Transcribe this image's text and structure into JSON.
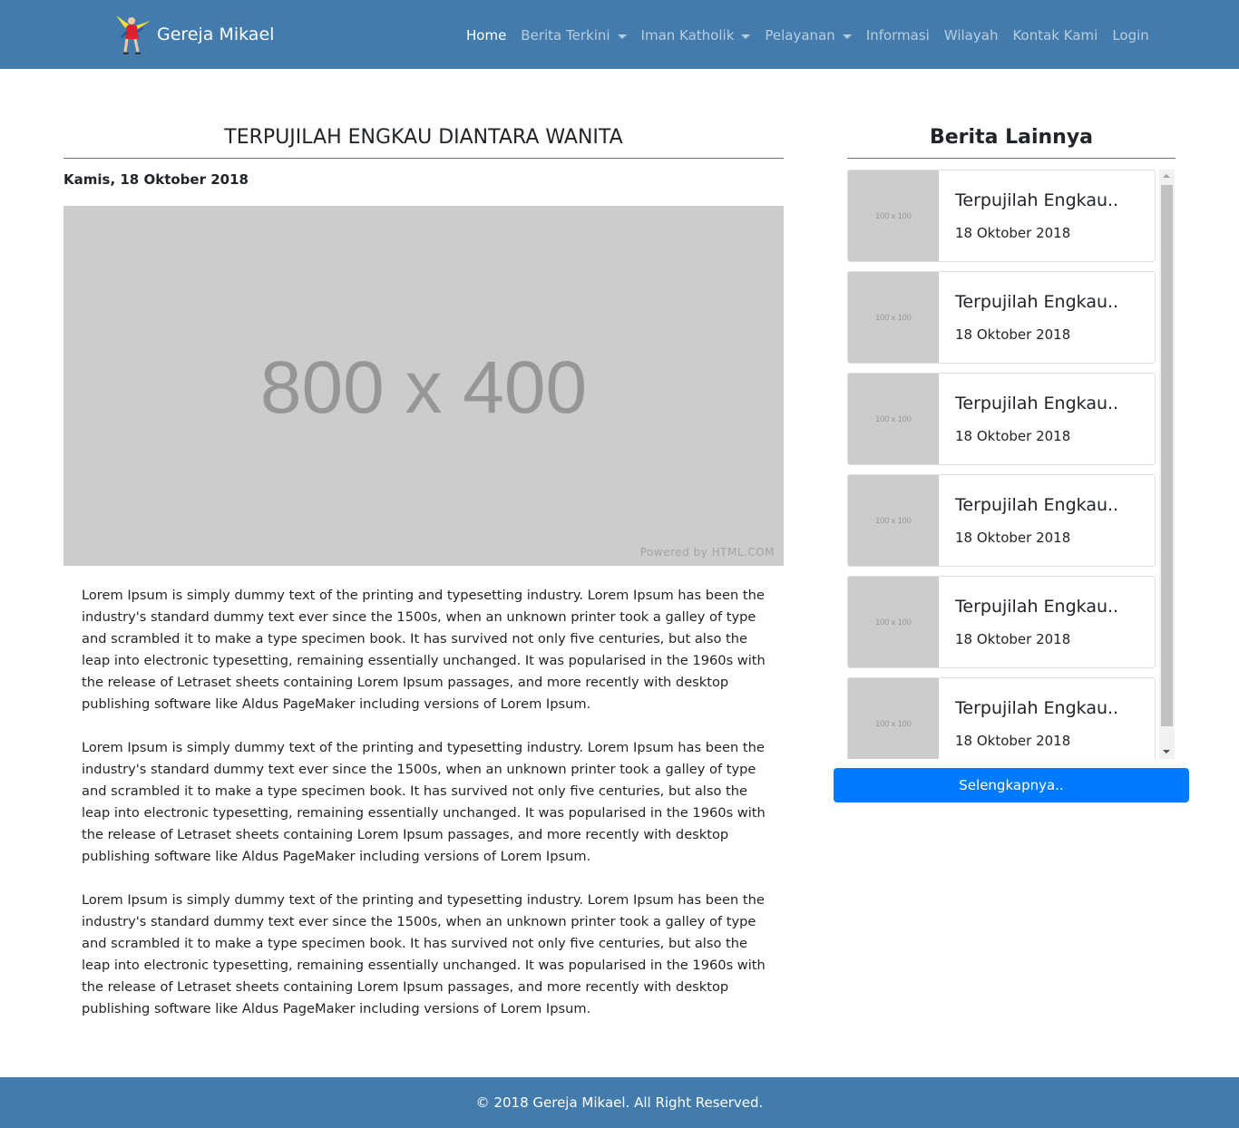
{
  "brand": {
    "name": "Gereja Mikael",
    "logo_icon": "archangel-logo-icon"
  },
  "nav": {
    "items": [
      {
        "label": "Home",
        "active": true,
        "dropdown": false
      },
      {
        "label": "Berita Terkini",
        "active": false,
        "dropdown": true
      },
      {
        "label": "Iman Katholik",
        "active": false,
        "dropdown": true
      },
      {
        "label": "Pelayanan",
        "active": false,
        "dropdown": true
      },
      {
        "label": "Informasi",
        "active": false,
        "dropdown": false
      },
      {
        "label": "Wilayah",
        "active": false,
        "dropdown": false
      },
      {
        "label": "Kontak Kami",
        "active": false,
        "dropdown": false
      },
      {
        "label": "Login",
        "active": false,
        "dropdown": false
      }
    ]
  },
  "article": {
    "title": "TERPUJILAH ENGKAU DIANTARA WANITA",
    "date": "Kamis, 18 Oktober 2018",
    "image": {
      "label": "800 x 400",
      "credit": "Powered by HTML.COM"
    },
    "paragraphs": [
      "Lorem Ipsum is simply dummy text of the printing and typesetting industry. Lorem Ipsum has been the industry's standard dummy text ever since the 1500s, when an unknown printer took a galley of type and scrambled it to make a type specimen book. It has survived not only five centuries, but also the leap into electronic typesetting, remaining essentially unchanged. It was popularised in the 1960s with the release of Letraset sheets containing Lorem Ipsum passages, and more recently with desktop publishing software like Aldus PageMaker including versions of Lorem Ipsum.",
      "Lorem Ipsum is simply dummy text of the printing and typesetting industry. Lorem Ipsum has been the industry's standard dummy text ever since the 1500s, when an unknown printer took a galley of type and scrambled it to make a type specimen book. It has survived not only five centuries, but also the leap into electronic typesetting, remaining essentially unchanged. It was popularised in the 1960s with the release of Letraset sheets containing Lorem Ipsum passages, and more recently with desktop publishing software like Aldus PageMaker including versions of Lorem Ipsum.",
      "Lorem Ipsum is simply dummy text of the printing and typesetting industry. Lorem Ipsum has been the industry's standard dummy text ever since the 1500s, when an unknown printer took a galley of type and scrambled it to make a type specimen book. It has survived not only five centuries, but also the leap into electronic typesetting, remaining essentially unchanged. It was popularised in the 1960s with the release of Letraset sheets containing Lorem Ipsum passages, and more recently with desktop publishing software like Aldus PageMaker including versions of Lorem Ipsum."
    ]
  },
  "sidebar": {
    "title": "Berita Lainnya",
    "items": [
      {
        "thumb": "100 x 100",
        "title": "Terpujilah Engkau..",
        "date": "18 Oktober 2018"
      },
      {
        "thumb": "100 x 100",
        "title": "Terpujilah Engkau..",
        "date": "18 Oktober 2018"
      },
      {
        "thumb": "100 x 100",
        "title": "Terpujilah Engkau..",
        "date": "18 Oktober 2018"
      },
      {
        "thumb": "100 x 100",
        "title": "Terpujilah Engkau..",
        "date": "18 Oktober 2018"
      },
      {
        "thumb": "100 x 100",
        "title": "Terpujilah Engkau..",
        "date": "18 Oktober 2018"
      },
      {
        "thumb": "100 x 100",
        "title": "Terpujilah Engkau..",
        "date": "18 Oktober 2018"
      }
    ],
    "more_label": "Selengkapnya.."
  },
  "footer": {
    "text": "© 2018 Gereja Mikael. All Right Reserved."
  },
  "colors": {
    "navbar": "#437bac",
    "button": "#007bff",
    "placeholder": "#cccccc"
  }
}
